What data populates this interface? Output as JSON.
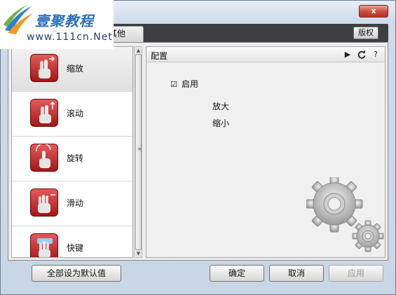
{
  "window": {
    "close_label": "x"
  },
  "watermark": {
    "title": "壹聚教程",
    "url": "www.111cn.Net"
  },
  "tabs": {
    "other_label": "其他",
    "copyright_label": "版权"
  },
  "gesture_list": {
    "items": [
      {
        "label": "缩放",
        "icon": "zoom-gesture-icon",
        "selected": true
      },
      {
        "label": "滚动",
        "icon": "scroll-gesture-icon",
        "selected": false
      },
      {
        "label": "旋转",
        "icon": "rotate-gesture-icon",
        "selected": false
      },
      {
        "label": "滑动",
        "icon": "swipe-gesture-icon",
        "selected": false
      },
      {
        "label": "快键",
        "icon": "shortcut-gesture-icon",
        "selected": false
      }
    ]
  },
  "panel": {
    "title": "配置",
    "play_icon": "play-icon",
    "refresh_icon": "refresh-icon",
    "help_label": "?",
    "enable_label": "启用",
    "enable_checked": true,
    "option_zoom_in": "放大",
    "option_zoom_out": "缩小",
    "decoration_icon": "gears-icon"
  },
  "footer": {
    "defaults_label": "全部设为默认值",
    "ok_label": "确定",
    "cancel_label": "取消",
    "apply_label": "应用"
  },
  "colors": {
    "accent_red": "#c0282b",
    "tab_strip": "#3d3f42",
    "watermark_blue": "#2a6fba"
  }
}
